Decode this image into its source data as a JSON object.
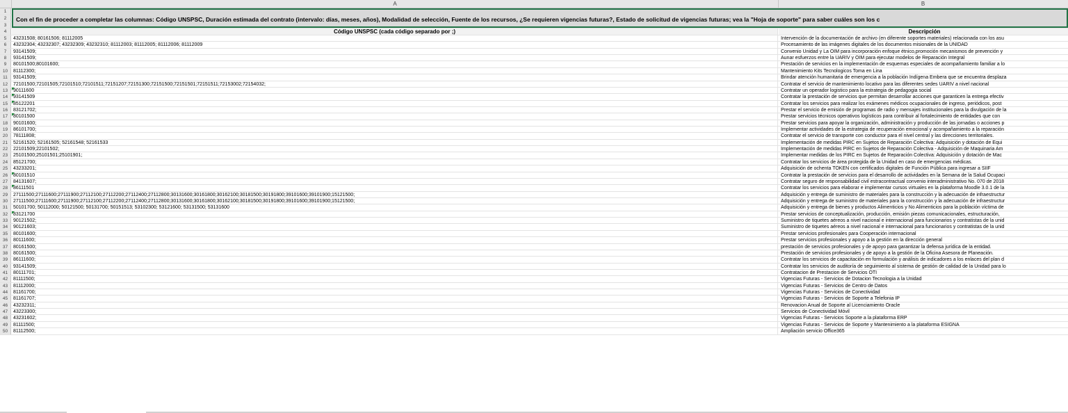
{
  "columns": {
    "a": "A",
    "b": "B"
  },
  "banner": {
    "text": "Con el fin de proceder a completar las columnas: Código UNSPSC, Duración estimada del contrato (intervalo: días, meses, años), Modalidad de selección, Fuente de los recursos, ¿Se requieren vigencias futuras?, Estado de solicitud de vigencias futuras; vea la \"Hoja de soporte\" para saber cuáles son los c"
  },
  "header_row": {
    "col_a": "Código UNSPSC (cada código separado por ;)",
    "col_b": "Descripción"
  },
  "top_rows": [
    "1",
    "2",
    "3",
    "4"
  ],
  "rows": [
    {
      "n": "5",
      "a": "43231508; 80161506; 81112005",
      "b": "Intervención de la documentación de archivo (en diferente soportes materiales) relacionada con los asu"
    },
    {
      "n": "6",
      "a": "43232304; 43232307; 43232309; 43232310; 81112003; 81112005; 81112006; 81112009",
      "b": "Procesamiento de las imágenes digitales de los documentos misionales de la UNIDAD"
    },
    {
      "n": "7",
      "a": "93141509;",
      "b": "Convenio Unidad y La OIM para incorporación enfoque étnico,promoción mecanismos de prevención y"
    },
    {
      "n": "8",
      "a": "93141509;",
      "b": "Aunar esfuerzos entre la UARIV y OIM para ejecutar modelos de Reparación Integral"
    },
    {
      "n": "9",
      "a": "80101500;80101600;",
      "b": "Prestación de servicios en la implementación de esquemas especiales de acompañamiento familiar a lo"
    },
    {
      "n": "10",
      "a": "81112300;",
      "b": "Mantenimiento Kits Tecnologicos Toma en Lina"
    },
    {
      "n": "11",
      "a": "93141509;",
      "b": "Brindar atención humanitaria de emergencia a la población Indígena Embera que se encuentra desplaza"
    },
    {
      "n": "12",
      "a": "72101500;72101505;72101510;72101511;72151207;72151300;72151500;72151501;72151511;72153002;72154032;",
      "b": "Contratar el servicio de mantenimiento locativo para las diferentes sedes UARIV a nivel nacional"
    },
    {
      "n": "13",
      "a": "90111600",
      "b": "Contratar un operador logistico para la estrategia de pedagogia social",
      "flag": true
    },
    {
      "n": "14",
      "a": "93141509",
      "b": "Contratar la prestación de servicios que permitan desarrollar acciones que garanticen la entrega efectiv",
      "flag": true
    },
    {
      "n": "15",
      "a": "85122201",
      "b": "Contratar los servicios para realizar los exámenes médicos ocupacionales de ingreso, periódicos, post",
      "flag": true
    },
    {
      "n": "16",
      "a": "83121702;",
      "b": "Prestar el servicio de emisión de programas de radio y mensajes institucionales para la divulgación de la"
    },
    {
      "n": "17",
      "a": "80101500",
      "b": "Prestar servicios técnicos operativos logísticos para contribuir al fortalecimiento de entidades que con",
      "flag": true
    },
    {
      "n": "18",
      "a": "90101600;",
      "b": "Prestar servicios para apoyar la organización, administración y producción de las jornadas o acciones p"
    },
    {
      "n": "19",
      "a": "86101700;",
      "b": "Implementar actividades de la estrategia de recuperación emocional y acompañamiento a la reparación"
    },
    {
      "n": "20",
      "a": "78111808;",
      "b": "Contratar el servicio de transporte con conductor para el nivel central y las direcciones territoriales."
    },
    {
      "n": "21",
      "a": "52161520; 52161505; 52161548; 52161533",
      "b": "Implementación de medidas PIRC en Sujetos de Reparación Colectiva:  Adquisición y dotación de Equi"
    },
    {
      "n": "22",
      "a": "22101509;22101502;",
      "b": "Implementación de medidas PIRC en Sujetos de Reparación Colectiva - Adquisición de Maquinaria Am"
    },
    {
      "n": "23",
      "a": "25101500;25101501;25101901;",
      "b": "Implementar  medidas de los  PIRC en Sujetos de Reparación Colectiva: Adquisición y dotación de Mac"
    },
    {
      "n": "24",
      "a": "85121700;",
      "b": "Contratar los servicios de área protegida de la Unidad en caso de emergencias médicas."
    },
    {
      "n": "25",
      "a": "43233201;",
      "b": "Adquisición de ochenta TOKEN con certificados digitales de Función Pública para ingresar a SIIF"
    },
    {
      "n": "26",
      "a": "80101510",
      "b": "Contratar la prestación de servicios para el desarrollo de actividades en la Semana de la Salud Ocupaci",
      "flag": true
    },
    {
      "n": "27",
      "a": "84131607;",
      "b": "Contratar seguro de responsabilidad civil estracontractual convenio interadministrativo No. 070 de 2018"
    },
    {
      "n": "28",
      "a": "86111501",
      "b": "Contratar los servicios para elaborar e implementar cursos virtuales en la plataforma Moodle 3.0.1 de la",
      "flag": true
    },
    {
      "n": "29",
      "a": "27111500;27111600;27111900;27112100;27112200;27112400;27112800;30131600;30161800;30162100;30181500;30191800;39101600;39101900;15121500;",
      "b": "Adquisición y entrega de suministro de materiales para la construcción y la adecuación de infraestructur"
    },
    {
      "n": "30",
      "a": "27111500;27111600;27111900;27112100;27112200;27112400;27112800;30131600;30161800;30162100;30181500;30191800;39101600;39101900;15121500;",
      "b": "Adquisición y entrega de suministro de materiales para la construcción y la adecuación de infraestructur"
    },
    {
      "n": "31",
      "a": "50101700; 50112000; 50121500; 50131700; 50151513; 53102300; 53121600; 53131500; 53131600",
      "b": "Adquisición y entrega de bienes y productos Alimenticios y No Alimenticios para la población víctima de"
    },
    {
      "n": "32",
      "a": "83121700",
      "b": "Prestar servicios de conceptualización, producción, emisión piezas comunicacionales, estructuración,",
      "flag": true
    },
    {
      "n": "33",
      "a": "90121502;",
      "b": "Suministro de tiquetes aéreos a nivel nacional e internacional para funcionarios y contratistas de la unid"
    },
    {
      "n": "34",
      "a": "90121603;",
      "b": "Suministro de tiquetes aéreos a nivel nacional e internacional para funcionarios y contratistas de la unid"
    },
    {
      "n": "35",
      "a": "80101600;",
      "b": "Prestar servicios profesionales para Cooperación internacional"
    },
    {
      "n": "36",
      "a": "80111600;",
      "b": "Prestar servicios profesionales y apoyo a la gestión en la dirección general"
    },
    {
      "n": "37",
      "a": "80161500;",
      "b": "prestación de servicios profesionales y de apoyo para garantizar la defensa jurídica de la entidad."
    },
    {
      "n": "38",
      "a": "80161500;",
      "b": "Prestación de servicios profesionales y de apoyo a la gestión de la Oficina Asesora de Planeación."
    },
    {
      "n": "39",
      "a": "86111600;",
      "b": "Contratar los servicios de capacitación en formulación y análisis de indicadores a los enlaces del plan d"
    },
    {
      "n": "40",
      "a": "93141509;",
      "b": "Contratar los servicios de auditoría de seguimiento al sistema de gestión de calidad de la Unidad para lo"
    },
    {
      "n": "41",
      "a": "80111701;",
      "b": "Contratacion de Prestacion de Servicios OTI"
    },
    {
      "n": "42",
      "a": "81111500;",
      "b": "Vigencias Futuras - Servicios de Dotacion Tecnologia a la Unidad"
    },
    {
      "n": "43",
      "a": "81112000;",
      "b": "Vigencias Futuras - Servicios de Centro de Datos"
    },
    {
      "n": "44",
      "a": "81161700;",
      "b": "Vigencias Futuras - Servicios de Conectividad"
    },
    {
      "n": "45",
      "a": "81161707;",
      "b": "Vigencias Futuras - Servicios  de Soporte a  Telefonia IP"
    },
    {
      "n": "46",
      "a": "43232311;",
      "b": "Renovacion Anual de Soporte al Licenciamiento Oracle"
    },
    {
      "n": "47",
      "a": "43223300;",
      "b": "Servicios de Conectividad Móvil"
    },
    {
      "n": "48",
      "a": "43231602;",
      "b": "Vigencias Futuras - Servicios Soporte a la plataforma ERP"
    },
    {
      "n": "49",
      "a": "81111500;",
      "b": "Vigencias Futuras - Servicios de Soporte y Mantenimiento a la plataforma ESIGNA"
    },
    {
      "n": "50",
      "a": "81112500;",
      "b": "Ampliación servicio Office365"
    }
  ],
  "colors": {
    "selection_border": "#217346",
    "banner_fill": "#d9d9d9",
    "header_fill": "#e7e7e7",
    "flag": "#1e8a3a"
  }
}
